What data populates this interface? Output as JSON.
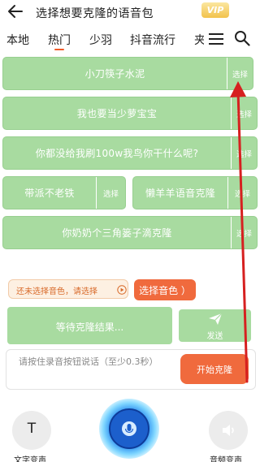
{
  "header": {
    "title": "选择想要克隆的语音包",
    "vip": "VIP"
  },
  "tabs": [
    {
      "label": "本地"
    },
    {
      "label": "热门"
    },
    {
      "label": "少羽"
    },
    {
      "label": "抖音流行"
    },
    {
      "label": "夹"
    }
  ],
  "voices": [
    {
      "label": "小刀筷子水泥",
      "select": "选择"
    },
    {
      "label": "我也要当少萝宝宝",
      "select": "选择"
    },
    {
      "label": "你都没给我刷100w我鸟你干什么呢?",
      "select": "选择"
    },
    {
      "label": "带派不老铁",
      "select": "选择"
    },
    {
      "label": "懒羊羊语音克隆",
      "select": "选择"
    },
    {
      "label": "你奶奶个三角篓子滴克隆",
      "select": "选择"
    }
  ],
  "status": {
    "hint": "还未选择音色，请选择",
    "pick_button": "选择音色 ）"
  },
  "clone": {
    "result": "等待克隆结果...",
    "send": "发送",
    "input_placeholder": "请按住录音按钮说话（至少0.3秒）",
    "start": "开始克隆"
  },
  "bottom": {
    "left_label": "文字变声",
    "right_label": "音频变声",
    "left_glyph": "T"
  },
  "colors": {
    "voice_bg": "#a8dba0",
    "accent": "#f06a3d",
    "tab_underline": "#f05a28",
    "annotation_arrow": "#d62020"
  }
}
